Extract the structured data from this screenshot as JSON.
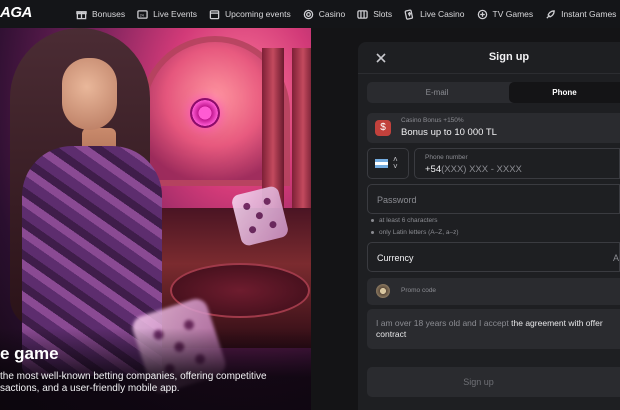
{
  "brand": {
    "logo_text": "AGA"
  },
  "nav": {
    "items": [
      {
        "label": "Bonuses",
        "icon": "gift-icon"
      },
      {
        "label": "Live Events",
        "icon": "live-icon"
      },
      {
        "label": "Upcoming events",
        "icon": "calendar-icon"
      },
      {
        "label": "Casino",
        "icon": "chip-icon"
      },
      {
        "label": "Slots",
        "icon": "slots-icon"
      },
      {
        "label": "Live Casino",
        "icon": "card-icon"
      },
      {
        "label": "TV Games",
        "icon": "tv-icon"
      },
      {
        "label": "Instant Games",
        "icon": "rocket-icon"
      }
    ]
  },
  "hero": {
    "title": "e game",
    "text": "the most well-known betting companies, offering competitive sactions, and a user-friendly mobile app."
  },
  "modal": {
    "title": "Sign up",
    "tabs": {
      "email": "E-mail",
      "phone": "Phone",
      "active": "phone"
    },
    "bonus": {
      "label": "Casino Bonus +150%",
      "value": "Bonus up to 10 000 TL"
    },
    "phone": {
      "label": "Phone number",
      "prefix": "+54",
      "placeholder": "(XXX) XXX - XXXX"
    },
    "password": {
      "placeholder": "Password"
    },
    "hints": [
      "at least 6 characters",
      "only Latin letters (A–Z, a–z)"
    ],
    "currency": {
      "label": "Currency",
      "value": "A"
    },
    "promo": {
      "label": "Promo code"
    },
    "agreement": {
      "text": "I am over 18 years old and I accept",
      "link": "the agreement with offer contract"
    },
    "submit_label": "Sign up"
  },
  "colors": {
    "modal_bg": "#1e1f22",
    "page_bg": "#131416",
    "field_bg": "#2a2b2f",
    "bonus_icon": "#c2413c"
  }
}
